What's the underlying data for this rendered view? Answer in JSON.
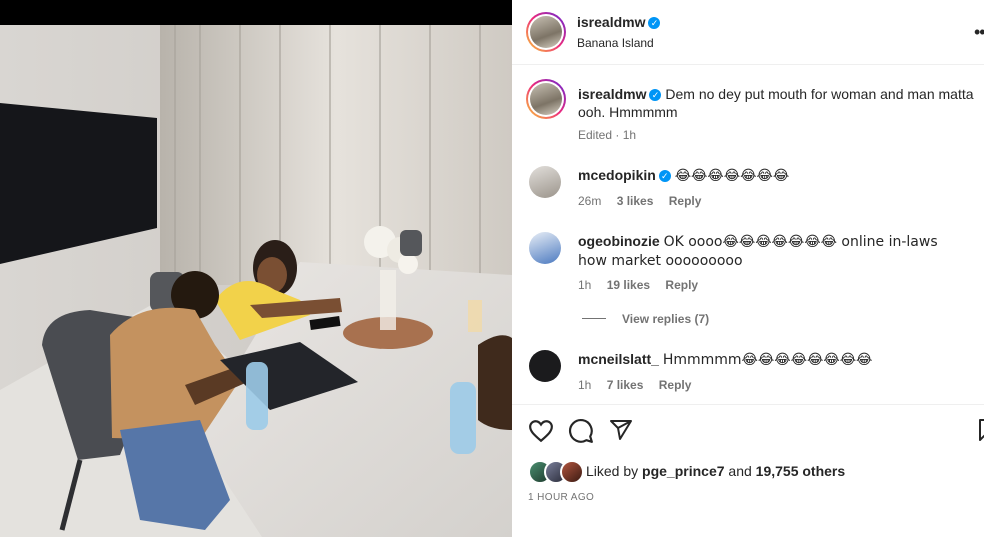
{
  "post": {
    "username": "isrealdmw",
    "location": "Banana Island",
    "more_icon": "more-icon",
    "caption": "Dem no dey put mouth for woman and man matta ooh. Hmmmmm",
    "caption_meta": "Edited · 1h"
  },
  "comments": [
    {
      "user": "mcedopikin",
      "verified": true,
      "text": "😂😂😂😂😂😂😂",
      "time": "26m",
      "likes": "3 likes",
      "reply": "Reply"
    },
    {
      "user": "ogeobinozie",
      "verified": false,
      "text": "OK oooo😂😂😂😂😂😂😂 online in-laws how market ooooooooo",
      "time": "1h",
      "likes": "19 likes",
      "reply": "Reply",
      "view_replies": "View replies (7)"
    },
    {
      "user": "mcneilslatt_",
      "verified": false,
      "text": "Hmmmmm😂😂😂😂😂😂😂😂",
      "time": "1h",
      "likes": "7 likes",
      "reply": "Reply"
    }
  ],
  "actions": {
    "icons": [
      "heart-icon",
      "comment-icon",
      "share-icon",
      "bookmark-icon"
    ]
  },
  "likes": {
    "prefix": "Liked by ",
    "user": "pge_prince7",
    "middle": " and ",
    "count": "19,755 others"
  },
  "timestamp": "1 HOUR AGO",
  "colors": {
    "verified": "#0095f6",
    "text": "#262626",
    "muted": "#737373"
  }
}
